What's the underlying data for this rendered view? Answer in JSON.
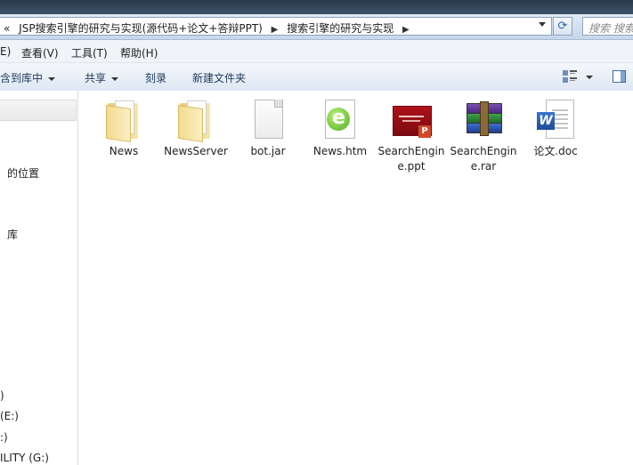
{
  "address_bar": {
    "back_chevron": "«",
    "crumbs": [
      "JSP搜索引擎的研究与实现(源代码+论文+答辩PPT)",
      "搜索引擎的研究与实现"
    ],
    "search_placeholder": "搜索 搜索..."
  },
  "menu": {
    "edit": "E)",
    "view": "查看(V)",
    "tools": "工具(T)",
    "help": "帮助(H)"
  },
  "toolbar": {
    "include_in_library": "包含到库中",
    "share": "共享",
    "burn": "刻录",
    "new_folder": "新建文件夹"
  },
  "nav": {
    "items": [
      "的位置",
      "库",
      ")",
      "(E:)",
      ":)",
      "ILITY (G:)"
    ]
  },
  "files": [
    {
      "name": "News",
      "icon": "folder-icon"
    },
    {
      "name": "NewsServer",
      "icon": "folder-icon"
    },
    {
      "name": "bot.jar",
      "icon": "jar-file-icon"
    },
    {
      "name": "News.htm",
      "icon": "html-file-icon"
    },
    {
      "name": "SearchEngine.ppt",
      "icon": "powerpoint-file-icon"
    },
    {
      "name": "SearchEngine.rar",
      "icon": "winrar-archive-icon"
    },
    {
      "name": "论文.doc",
      "icon": "word-document-icon"
    }
  ]
}
